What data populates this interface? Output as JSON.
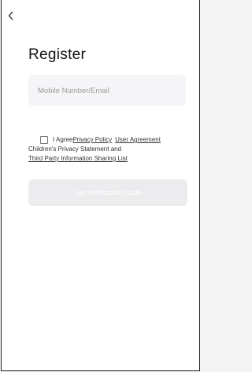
{
  "nav": {
    "back_icon": "chevron-left-icon"
  },
  "page": {
    "title": "Register"
  },
  "form": {
    "account_placeholder": "Mobile Number/Email",
    "account_value": ""
  },
  "agreement": {
    "checked": false,
    "prefix": "I Agree",
    "privacy_policy": "Privacy Policy",
    "user_agreement": "User Agreement",
    "childrens_privacy": "Children's Privacy Statement",
    "and": "and",
    "third_party": "Third Party Information Sharing List"
  },
  "actions": {
    "get_code_label": "Get Verification Code",
    "get_code_enabled": false
  },
  "colors": {
    "background": "#ffffff",
    "input_bg": "#f5f5f7",
    "button_disabled_bg": "#ececef",
    "text": "#111111",
    "placeholder": "#9a9a9a"
  }
}
